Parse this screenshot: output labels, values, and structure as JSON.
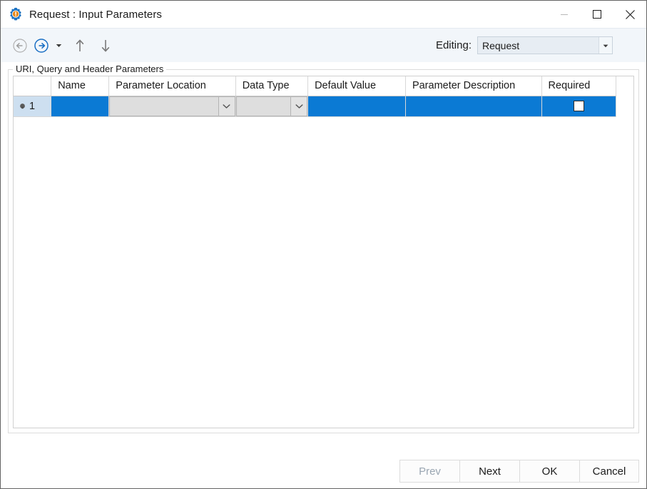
{
  "window": {
    "title": "Request : Input Parameters",
    "icon": "gear-icon",
    "controls": {
      "minimize": "minimize-icon",
      "maximize": "maximize-icon",
      "close": "close-icon"
    }
  },
  "toolbar": {
    "back": "back-arrow-icon",
    "forward": "forward-arrow-icon",
    "forward_dropdown": "caret-down-icon",
    "move_up": "up-arrow-icon",
    "move_down": "down-arrow-icon",
    "editing_label": "Editing:",
    "editing_value": "Request",
    "editing_options": [
      "Request"
    ],
    "editing_arrow": "caret-down-icon"
  },
  "groupbox": {
    "legend": "URI, Query and Header Parameters"
  },
  "grid": {
    "columns": [
      {
        "key": "rowhdr",
        "label": ""
      },
      {
        "key": "name",
        "label": "Name"
      },
      {
        "key": "location",
        "label": "Parameter Location"
      },
      {
        "key": "datatype",
        "label": "Data Type"
      },
      {
        "key": "default",
        "label": "Default Value"
      },
      {
        "key": "description",
        "label": "Parameter Description"
      },
      {
        "key": "required",
        "label": "Required"
      }
    ],
    "rows": [
      {
        "row_number": "1",
        "marker": "edit-row-marker-icon",
        "name": "",
        "location": "",
        "location_arrow": "chevron-down-icon",
        "datatype": "",
        "datatype_arrow": "chevron-down-icon",
        "default": "",
        "description": "",
        "required_checked": false
      }
    ]
  },
  "footer": {
    "buttons": [
      {
        "label": "Prev",
        "disabled": true
      },
      {
        "label": "Next",
        "disabled": false
      },
      {
        "label": "OK",
        "disabled": false
      },
      {
        "label": "Cancel",
        "disabled": false
      }
    ]
  },
  "colors": {
    "accent_selection": "#0b7ad4",
    "rowheader_selected": "#cddff0",
    "toolbar_bg": "#f2f6fa",
    "forward_arrow": "#1a6fc4",
    "icon_gear_blue": "#1d72c2",
    "icon_gear_orange": "#e8881a"
  }
}
